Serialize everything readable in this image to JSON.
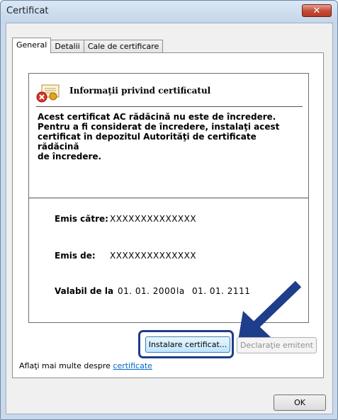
{
  "window": {
    "title": "Certificat",
    "close_symbol": "✕"
  },
  "tabs": [
    {
      "label": "General"
    },
    {
      "label": "Detalii"
    },
    {
      "label": "Cale de certificare"
    }
  ],
  "cert_info": {
    "title": "Informaţii privind certificatul",
    "warning_lines": [
      "Acest certificat AC rădăcină nu este de încredere.",
      "Pentru a fi considerat de încredere, instalaţi acest",
      "certificat în depozitul Autorităţi de certificate rădăcină",
      "de încredere."
    ],
    "issued_to_label": "Emis către:",
    "issued_to_value": "XXXXXXXXXXXXXX",
    "issued_by_label": "Emis de:",
    "issued_by_value": "XXXXXXXXXXXXXX",
    "valid_label": "Valabil de la",
    "valid_from": "01. 01. 2000",
    "valid_to_label": "la",
    "valid_to": "01. 01. 2111"
  },
  "buttons": {
    "install": "Instalare certificat...",
    "statement": "Declaraţie emitent",
    "ok": "OK"
  },
  "learn_more": {
    "prefix": "Aflaţi mai multe despre",
    "link": "certificate"
  },
  "colors": {
    "highlight": "#1e3d8a",
    "arrow": "#1e3d8a",
    "close_button": "#c34a33"
  }
}
